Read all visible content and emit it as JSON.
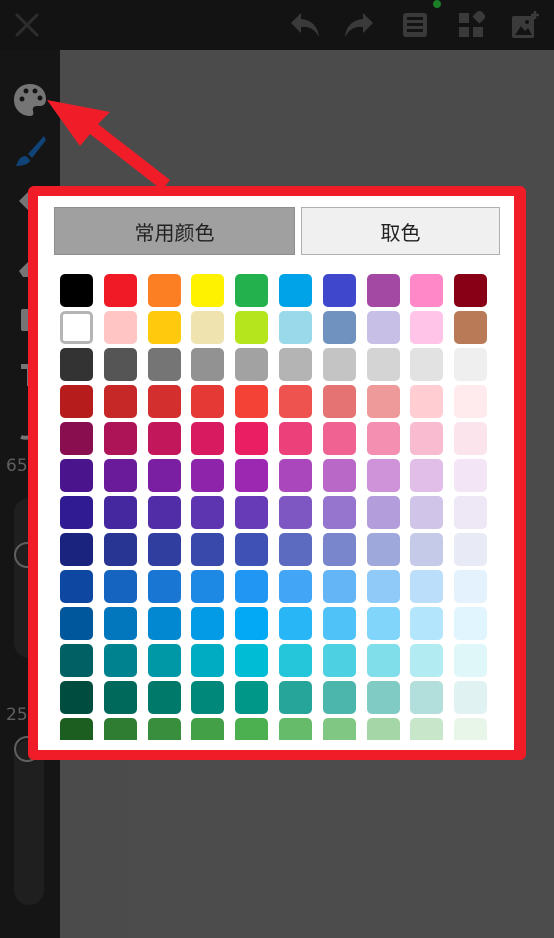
{
  "toolbar": {
    "close_icon": "close-icon",
    "undo_icon": "undo-icon",
    "redo_icon": "redo-icon",
    "save_icon": "save-icon",
    "layers_icon": "layers-icon",
    "add_image_icon": "add-image-icon"
  },
  "sidebar": {
    "size_value": "65",
    "opacity_value": "25"
  },
  "popup": {
    "tab_common": "常用颜色",
    "tab_pick": "取色",
    "selected_index": 10,
    "swatches": [
      "#000000",
      "#ef1a26",
      "#fd7f24",
      "#fff200",
      "#22b14c",
      "#00a2e8",
      "#3f48cc",
      "#a349a4",
      "#ff88c8",
      "#880015",
      "#ffffff",
      "#ffc4c4",
      "#ffc90e",
      "#efe4b0",
      "#b5e61d",
      "#99d9ea",
      "#7092be",
      "#c8bfe7",
      "#ffc4e8",
      "#b97a57",
      "#333333",
      "#555555",
      "#757575",
      "#929292",
      "#a2a2a2",
      "#b4b4b4",
      "#c4c4c4",
      "#d4d4d4",
      "#e2e2e2",
      "#efefef",
      "#b71c1c",
      "#c62828",
      "#d32f2f",
      "#e53935",
      "#f44336",
      "#ef5350",
      "#e57373",
      "#ef9a9a",
      "#ffcdd2",
      "#ffebee",
      "#880e4f",
      "#ad1457",
      "#c2185b",
      "#d81b60",
      "#e91e63",
      "#ec407a",
      "#f06292",
      "#f48fb1",
      "#f8bbd0",
      "#fce4ec",
      "#4a148c",
      "#6a1b9a",
      "#7b1fa2",
      "#8e24aa",
      "#9c27b0",
      "#ab47bc",
      "#ba68c8",
      "#ce93d8",
      "#e1bee7",
      "#f3e5f5",
      "#311b92",
      "#4527a0",
      "#512da8",
      "#5e35b1",
      "#673ab7",
      "#7e57c2",
      "#9575cd",
      "#b39ddb",
      "#d1c4e9",
      "#ede7f6",
      "#1a237e",
      "#283593",
      "#303f9f",
      "#3949ab",
      "#3f51b5",
      "#5c6bc0",
      "#7986cb",
      "#9fa8da",
      "#c5cae9",
      "#e8eaf6",
      "#0d47a1",
      "#1565c0",
      "#1976d2",
      "#1e88e5",
      "#2196f3",
      "#42a5f5",
      "#64b5f6",
      "#90caf9",
      "#bbdefb",
      "#e3f2fd",
      "#01579b",
      "#0277bd",
      "#0288d1",
      "#039be5",
      "#03a9f4",
      "#29b6f6",
      "#4fc3f7",
      "#81d4fa",
      "#b3e5fc",
      "#e1f5fe",
      "#006064",
      "#00838f",
      "#0097a7",
      "#00acc1",
      "#00bcd4",
      "#26c6da",
      "#4dd0e1",
      "#80deea",
      "#b2ebf2",
      "#e0f7fa",
      "#004d40",
      "#00695c",
      "#00796b",
      "#00897b",
      "#009688",
      "#26a69a",
      "#4db6ac",
      "#80cbc4",
      "#b2dfdb",
      "#e0f2f1",
      "#1b5e20",
      "#2e7d32",
      "#388e3c",
      "#43a047",
      "#4caf50",
      "#66bb6a",
      "#81c784",
      "#a5d6a7",
      "#c8e6c9",
      "#e8f5e9"
    ]
  }
}
